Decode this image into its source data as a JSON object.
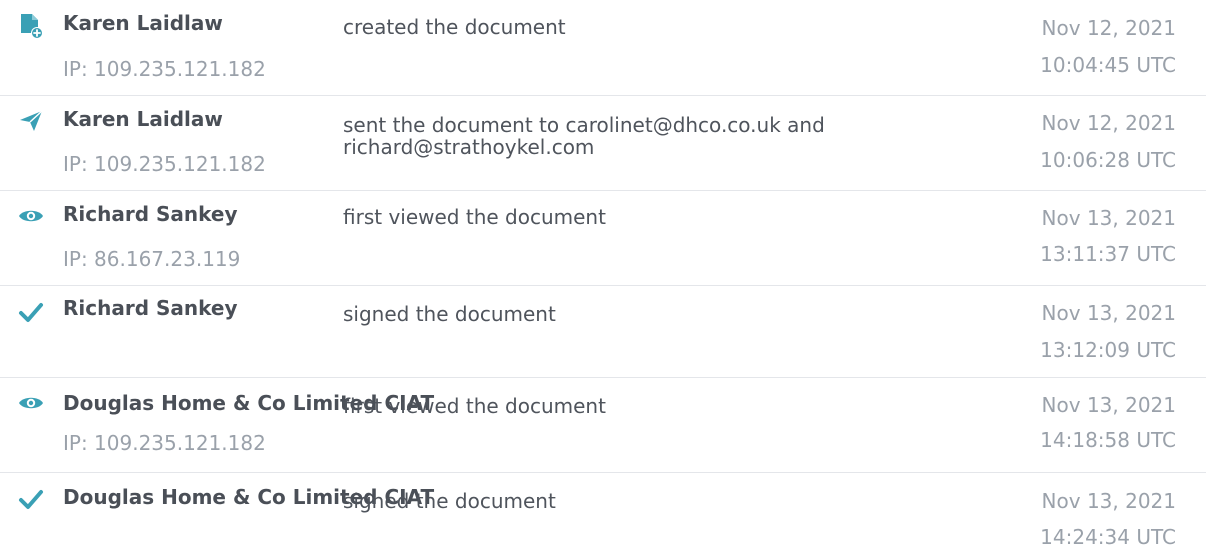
{
  "accent_color": "#3aa0b5",
  "events": [
    {
      "icon": "document-created-icon",
      "actor": "Karen Laidlaw",
      "ip": "IP: 109.235.121.182",
      "action": "created the document",
      "date": "Nov 12, 2021",
      "time": "10:04:45 UTC"
    },
    {
      "icon": "paper-plane-icon",
      "actor": "Karen Laidlaw",
      "ip": "IP: 109.235.121.182",
      "action": "sent the document to carolinet@dhco.co.uk and richard@strathoykel.com",
      "date": "Nov 12, 2021",
      "time": "10:06:28 UTC"
    },
    {
      "icon": "eye-icon",
      "actor": "Richard Sankey",
      "ip": "IP: 86.167.23.119",
      "action": "first viewed the document",
      "date": "Nov 13, 2021",
      "time": "13:11:37 UTC"
    },
    {
      "icon": "checkmark-icon",
      "actor": "Richard Sankey",
      "ip": "",
      "action": "signed the document",
      "date": "Nov 13, 2021",
      "time": "13:12:09 UTC"
    },
    {
      "icon": "eye-icon",
      "actor": "Douglas Home & Co Limited CIAT",
      "ip": "IP: 109.235.121.182",
      "action": "first viewed the document",
      "date": "Nov 13, 2021",
      "time": "14:18:58 UTC"
    },
    {
      "icon": "checkmark-icon",
      "actor": "Douglas Home & Co Limited CIAT",
      "ip": "",
      "action": "signed the document",
      "date": "Nov 13, 2021",
      "time": "14:24:34 UTC"
    }
  ]
}
